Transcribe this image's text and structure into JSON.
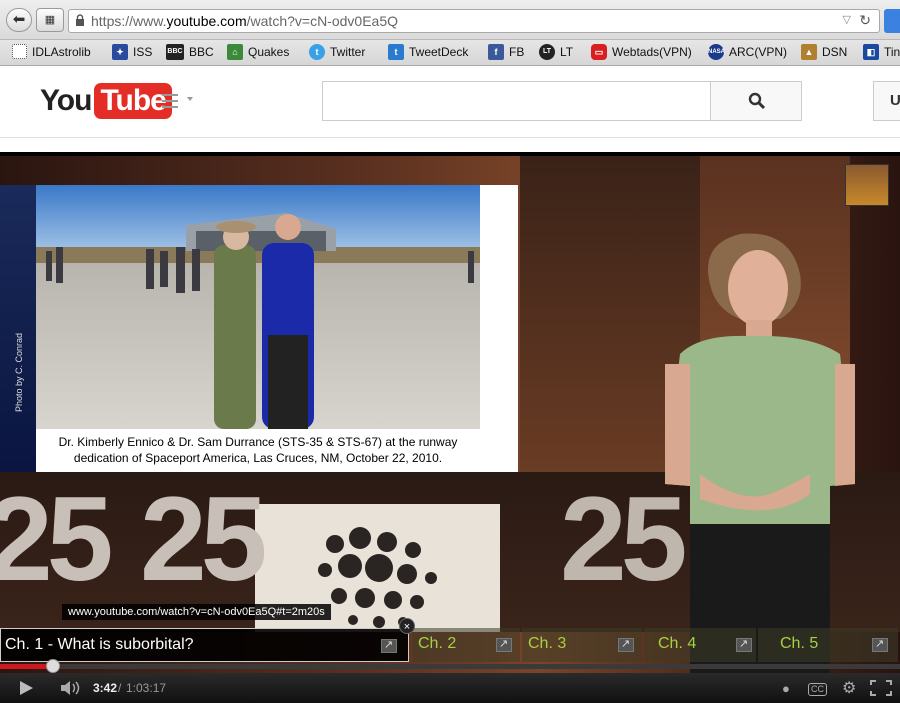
{
  "browser": {
    "url_prefix": "https://www.",
    "url_domain": "youtube.com",
    "url_path": "/watch?v=cN-odv0Ea5Q"
  },
  "bookmarks": [
    {
      "label": "IDLAstrolib",
      "icon": "dotted-box-icon",
      "color": "#ffffff"
    },
    {
      "label": "ISS",
      "icon": "iss-icon",
      "color": "#2a4aa0"
    },
    {
      "label": "BBC",
      "icon": "bbc-icon",
      "color": "#222222"
    },
    {
      "label": "Quakes",
      "icon": "quakes-icon",
      "color": "#3a8a3a"
    },
    {
      "label": "Twitter",
      "icon": "twitter-bird-icon",
      "color": "#3aa0e8"
    },
    {
      "label": "TweetDeck",
      "icon": "tweetdeck-icon",
      "color": "#2a7ad0"
    },
    {
      "label": "FB",
      "icon": "facebook-icon",
      "color": "#3b5998"
    },
    {
      "label": "LT",
      "icon": "lt-icon",
      "color": "#222222"
    },
    {
      "label": "Webtads(VPN)",
      "icon": "webtads-icon",
      "color": "#d81e1e"
    },
    {
      "label": "ARC(VPN)",
      "icon": "nasa-icon",
      "color": "#1a3a8a"
    },
    {
      "label": "DSN",
      "icon": "dsn-icon",
      "color": "#b08030"
    },
    {
      "label": "Tin",
      "icon": "tin-icon",
      "color": "#1a4aa0"
    }
  ],
  "youtube": {
    "logo_you": "You",
    "logo_tube": "Tube",
    "search_value": "",
    "upload_label": "U"
  },
  "video": {
    "slide_caption_line1": "Dr. Kimberly Ennico & Dr. Sam Durrance (STS-35 & STS-67) at the runway",
    "slide_caption_line2": "dedication of Spaceport America, Las Cruces, NM, October 22, 2010.",
    "photo_credit": "Photo by C. Conrad",
    "big_number": "25",
    "tooltip_url": "www.youtube.com/watch?v=cN-odv0Ea5Q#t=2m20s",
    "close_glyph": "×",
    "chapters": [
      {
        "label": "Ch. 1 - What is suborbital?"
      },
      {
        "label": "Ch. 2"
      },
      {
        "label": "Ch. 3"
      },
      {
        "label": "Ch. 4"
      },
      {
        "label": "Ch. 5"
      }
    ],
    "time_current": "3:42",
    "time_separator": "/",
    "time_total": "1:03:17",
    "progress_fraction": 0.0585,
    "accent_color": "#cc181e"
  }
}
